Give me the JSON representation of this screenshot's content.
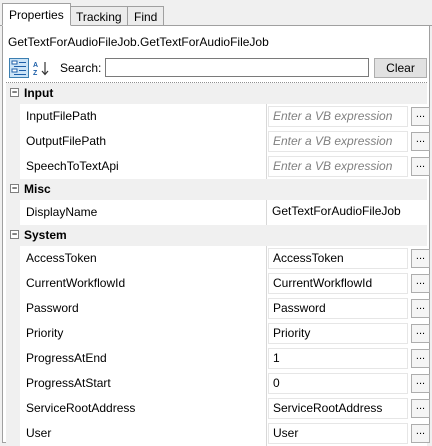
{
  "tabs": [
    {
      "label": "Properties",
      "active": true
    },
    {
      "label": "Tracking",
      "active": false
    },
    {
      "label": "Find",
      "active": false
    }
  ],
  "activity_title": "GetTextForAudioFileJob.GetTextForAudioFileJob",
  "toolbar": {
    "categorized_icon": "categorized-view-icon",
    "alphabetical_icon": "alphabetical-sort-icon",
    "search_label": "Search:",
    "search_value": "",
    "clear_label": "Clear"
  },
  "categories": [
    {
      "name": "Input",
      "properties": [
        {
          "name": "InputFilePath",
          "value": "Enter a VB expression",
          "placeholder": true,
          "has_button": true
        },
        {
          "name": "OutputFilePath",
          "value": "Enter a VB expression",
          "placeholder": true,
          "has_button": true
        },
        {
          "name": "SpeechToTextApi",
          "value": "Enter a VB expression",
          "placeholder": true,
          "has_button": true
        }
      ]
    },
    {
      "name": "Misc",
      "properties": [
        {
          "name": "DisplayName",
          "value": "GetTextForAudioFileJob",
          "placeholder": false,
          "has_button": false
        }
      ]
    },
    {
      "name": "System",
      "properties": [
        {
          "name": "AccessToken",
          "value": "AccessToken",
          "placeholder": false,
          "has_button": true
        },
        {
          "name": "CurrentWorkflowId",
          "value": "CurrentWorkflowId",
          "placeholder": false,
          "has_button": true
        },
        {
          "name": "Password",
          "value": "Password",
          "placeholder": false,
          "has_button": true
        },
        {
          "name": "Priority",
          "value": "Priority",
          "placeholder": false,
          "has_button": true
        },
        {
          "name": "ProgressAtEnd",
          "value": "1",
          "placeholder": false,
          "has_button": true
        },
        {
          "name": "ProgressAtStart",
          "value": "0",
          "placeholder": false,
          "has_button": true
        },
        {
          "name": "ServiceRootAddress",
          "value": "ServiceRootAddress",
          "placeholder": false,
          "has_button": true
        },
        {
          "name": "User",
          "value": "User",
          "placeholder": false,
          "has_button": true
        }
      ]
    }
  ],
  "ellipsis_label": "...",
  "collapse_glyph": "−"
}
